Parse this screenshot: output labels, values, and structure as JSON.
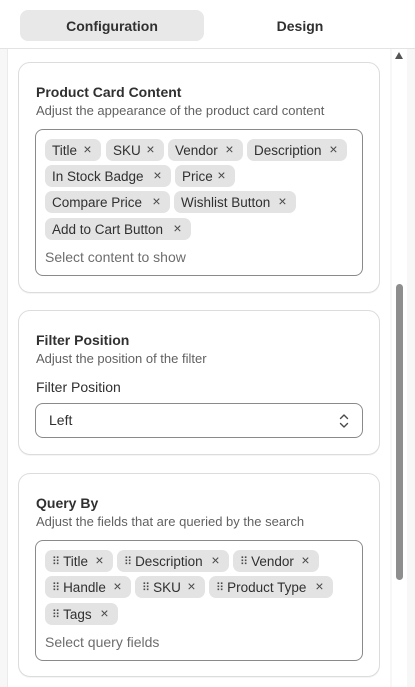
{
  "tabs": {
    "configuration": "Configuration",
    "design": "Design"
  },
  "product_card": {
    "title": "Product Card Content",
    "subtitle": "Adjust the appearance of the product card content",
    "tags": [
      "Title",
      "SKU",
      "Vendor",
      "Description",
      "In Stock Badge",
      "Price",
      "Compare Price",
      "Wishlist Button",
      "Add to Cart Button"
    ],
    "placeholder": "Select content to show"
  },
  "filter_position": {
    "title": "Filter Position",
    "subtitle": "Adjust the position of the filter",
    "field_label": "Filter Position",
    "selected": "Left"
  },
  "query_by": {
    "title": "Query By",
    "subtitle": "Adjust the fields that are queried by the search",
    "tags": [
      "Title",
      "Description",
      "Vendor",
      "Handle",
      "SKU",
      "Product Type",
      "Tags"
    ],
    "placeholder": "Select query fields"
  },
  "icons": {
    "remove": "close-icon",
    "drag": "drag-handle-icon",
    "select": "chevron-up-down-icon",
    "scroll": "scroll-up-arrow-icon"
  },
  "colors": {
    "tag_bg": "#e3e3e3",
    "active_tab_bg": "#e8e8e8",
    "border": "#8a8a8a"
  }
}
